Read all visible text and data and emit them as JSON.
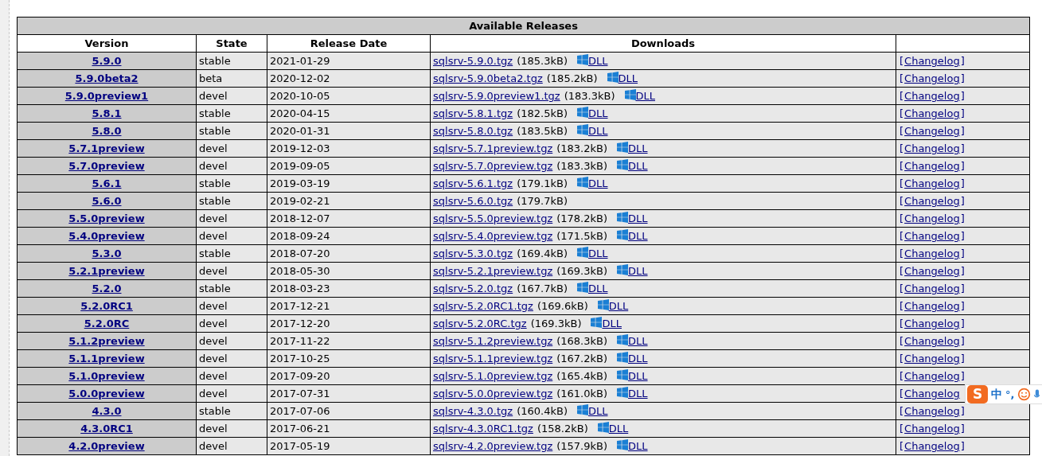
{
  "table": {
    "title": "Available Releases",
    "columns": [
      "Version",
      "State",
      "Release Date",
      "Downloads"
    ],
    "rows": [
      {
        "version": "5.9.0",
        "state": "stable",
        "date": "2021-01-29",
        "file": "sqlsrv-5.9.0.tgz",
        "size": "(185.3kB)",
        "dll": "DLL",
        "changelog": [
          "[",
          "Changelog",
          "]"
        ]
      },
      {
        "version": "5.9.0beta2",
        "state": "beta",
        "date": "2020-12-02",
        "file": "sqlsrv-5.9.0beta2.tgz",
        "size": "(185.2kB)",
        "dll": "DLL",
        "changelog": [
          "[",
          "Changelog",
          "]"
        ]
      },
      {
        "version": "5.9.0preview1",
        "state": "devel",
        "date": "2020-10-05",
        "file": "sqlsrv-5.9.0preview1.tgz",
        "size": "(183.3kB)",
        "dll": "DLL",
        "changelog": [
          "[",
          "Changelog",
          "]"
        ]
      },
      {
        "version": "5.8.1",
        "state": "stable",
        "date": "2020-04-15",
        "file": "sqlsrv-5.8.1.tgz",
        "size": "(182.5kB)",
        "dll": "DLL",
        "changelog": [
          "[",
          "Changelog",
          "]"
        ]
      },
      {
        "version": "5.8.0",
        "state": "stable",
        "date": "2020-01-31",
        "file": "sqlsrv-5.8.0.tgz",
        "size": "(183.5kB)",
        "dll": "DLL",
        "changelog": [
          "[",
          "Changelog",
          "]"
        ]
      },
      {
        "version": "5.7.1preview",
        "state": "devel",
        "date": "2019-12-03",
        "file": "sqlsrv-5.7.1preview.tgz",
        "size": "(183.2kB)",
        "dll": "DLL",
        "changelog": [
          "[",
          "Changelog",
          "]"
        ]
      },
      {
        "version": "5.7.0preview",
        "state": "devel",
        "date": "2019-09-05",
        "file": "sqlsrv-5.7.0preview.tgz",
        "size": "(183.3kB)",
        "dll": "DLL",
        "changelog": [
          "[",
          "Changelog",
          "]"
        ]
      },
      {
        "version": "5.6.1",
        "state": "stable",
        "date": "2019-03-19",
        "file": "sqlsrv-5.6.1.tgz",
        "size": "(179.1kB)",
        "dll": "DLL",
        "changelog": [
          "[",
          "Changelog",
          "]"
        ]
      },
      {
        "version": "5.6.0",
        "state": "stable",
        "date": "2019-02-21",
        "file": "sqlsrv-5.6.0.tgz",
        "size": "(179.7kB)",
        "changelog": [
          "[",
          "Changelog",
          "]"
        ]
      },
      {
        "version": "5.5.0preview",
        "state": "devel",
        "date": "2018-12-07",
        "file": "sqlsrv-5.5.0preview.tgz",
        "size": "(178.2kB)",
        "dll": "DLL",
        "changelog": [
          "[",
          "Changelog",
          "]"
        ]
      },
      {
        "version": "5.4.0preview",
        "state": "devel",
        "date": "2018-09-24",
        "file": "sqlsrv-5.4.0preview.tgz",
        "size": "(171.5kB)",
        "dll": "DLL",
        "changelog": [
          "[",
          "Changelog",
          "]"
        ]
      },
      {
        "version": "5.3.0",
        "state": "stable",
        "date": "2018-07-20",
        "file": "sqlsrv-5.3.0.tgz",
        "size": "(169.4kB)",
        "dll": "DLL",
        "changelog": [
          "[",
          "Changelog",
          "]"
        ]
      },
      {
        "version": "5.2.1preview",
        "state": "devel",
        "date": "2018-05-30",
        "file": "sqlsrv-5.2.1preview.tgz",
        "size": "(169.3kB)",
        "dll": "DLL",
        "changelog": [
          "[",
          "Changelog",
          "]"
        ]
      },
      {
        "version": "5.2.0",
        "state": "stable",
        "date": "2018-03-23",
        "file": "sqlsrv-5.2.0.tgz",
        "size": "(167.7kB)",
        "dll": "DLL",
        "changelog": [
          "[",
          "Changelog",
          "]"
        ]
      },
      {
        "version": "5.2.0RC1",
        "state": "devel",
        "date": "2017-12-21",
        "file": "sqlsrv-5.2.0RC1.tgz",
        "size": "(169.6kB)",
        "dll": "DLL",
        "changelog": [
          "[",
          "Changelog",
          "]"
        ]
      },
      {
        "version": "5.2.0RC",
        "state": "devel",
        "date": "2017-12-20",
        "file": "sqlsrv-5.2.0RC.tgz",
        "size": "(169.3kB)",
        "dll": "DLL",
        "changelog": [
          "[",
          "Changelog",
          "]"
        ]
      },
      {
        "version": "5.1.2preview",
        "state": "devel",
        "date": "2017-11-22",
        "file": "sqlsrv-5.1.2preview.tgz",
        "size": "(168.3kB)",
        "dll": "DLL",
        "changelog": [
          "[",
          "Changelog",
          "]"
        ]
      },
      {
        "version": "5.1.1preview",
        "state": "devel",
        "date": "2017-10-25",
        "file": "sqlsrv-5.1.1preview.tgz",
        "size": "(167.2kB)",
        "dll": "DLL",
        "changelog": [
          "[",
          "Changelog",
          "]"
        ]
      },
      {
        "version": "5.1.0preview",
        "state": "devel",
        "date": "2017-09-20",
        "file": "sqlsrv-5.1.0preview.tgz",
        "size": "(165.4kB)",
        "dll": "DLL",
        "changelog": [
          "[",
          "Changelog",
          "]"
        ]
      },
      {
        "version": "5.0.0preview",
        "state": "devel",
        "date": "2017-07-31",
        "file": "sqlsrv-5.0.0preview.tgz",
        "size": "(161.0kB)",
        "dll": "DLL",
        "changelog": [
          "[",
          "Changelog"
        ]
      },
      {
        "version": "4.3.0",
        "state": "stable",
        "date": "2017-07-06",
        "file": "sqlsrv-4.3.0.tgz",
        "size": "(160.4kB)",
        "dll": "DLL",
        "changelog": [
          "[",
          "Changelog",
          "]"
        ]
      },
      {
        "version": "4.3.0RC1",
        "state": "devel",
        "date": "2017-06-21",
        "file": "sqlsrv-4.3.0RC1.tgz",
        "size": "(158.2kB)",
        "dll": "DLL",
        "changelog": [
          "[",
          "Changelog",
          "]"
        ]
      },
      {
        "version": "4.2.0preview",
        "state": "devel",
        "date": "2017-05-19",
        "file": "sqlsrv-4.2.0preview.tgz",
        "size": "(157.9kB)",
        "dll": "DLL",
        "changelog": [
          "[",
          "Changelog",
          "]"
        ]
      }
    ]
  },
  "ime_toolbar": {
    "logo": "S",
    "mode": "中",
    "punctuation": "°,"
  }
}
